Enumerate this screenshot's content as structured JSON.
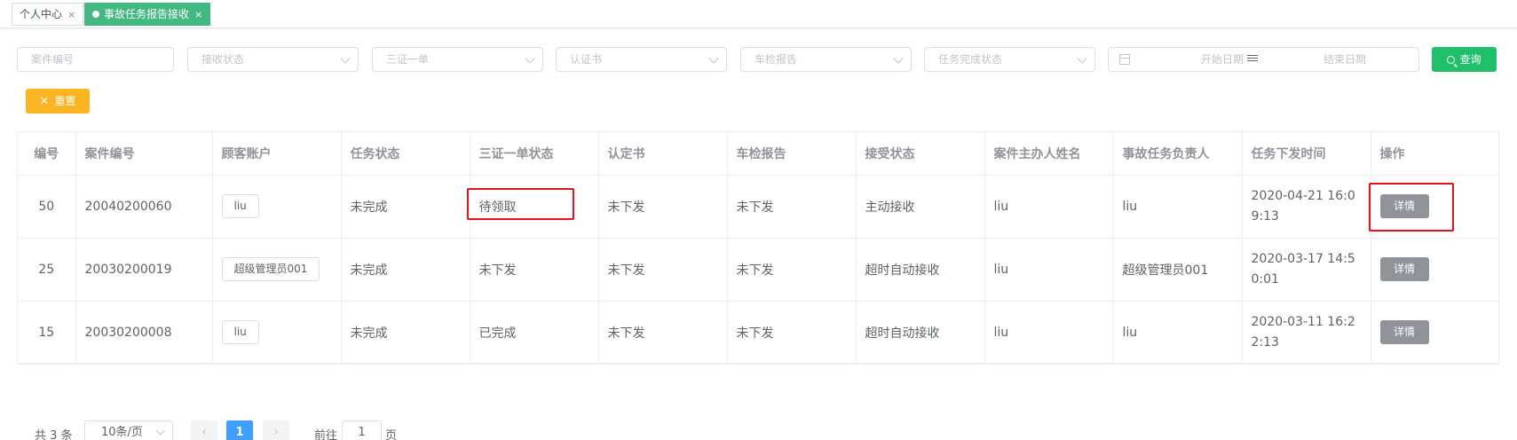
{
  "tabs": [
    {
      "label": "个人中心",
      "close": "×",
      "active": false
    },
    {
      "label": "事故任务报告接收",
      "close": "×",
      "active": true
    }
  ],
  "filters": {
    "case_no_placeholder": "案件编号",
    "receive_status_placeholder": "接收状态",
    "three_cert_placeholder": "三证一单",
    "certificate_placeholder": "认证书",
    "vehicle_report_placeholder": "车检报告",
    "task_complete_placeholder": "任务完成状态",
    "start_date_placeholder": "开始日期",
    "end_date_placeholder": "结束日期",
    "search_label": "查询",
    "reset_label": "重置"
  },
  "table": {
    "headers": [
      "编号",
      "案件编号",
      "顾客账户",
      "任务状态",
      "三证一单状态",
      "认定书",
      "车检报告",
      "接受状态",
      "案件主办人姓名",
      "事故任务负责人",
      "任务下发时间",
      "操作"
    ],
    "rows": [
      {
        "id": "50",
        "case_no": "20040200060",
        "account": "liu",
        "task_status": "未完成",
        "three_cert": "待领取",
        "certificate": "未下发",
        "vehicle_report": "未下发",
        "accept_status": "主动接收",
        "organizer": "liu",
        "manager": "liu",
        "issue_time": "2020-04-21 16:09:13",
        "action": "详情"
      },
      {
        "id": "25",
        "case_no": "20030200019",
        "account": "超级管理员001",
        "task_status": "未完成",
        "three_cert": "未下发",
        "certificate": "未下发",
        "vehicle_report": "未下发",
        "accept_status": "超时自动接收",
        "organizer": "liu",
        "manager": "超级管理员001",
        "issue_time": "2020-03-17 14:50:01",
        "action": "详情"
      },
      {
        "id": "15",
        "case_no": "20030200008",
        "account": "liu",
        "task_status": "未完成",
        "three_cert": "已完成",
        "certificate": "未下发",
        "vehicle_report": "未下发",
        "accept_status": "超时自动接收",
        "organizer": "liu",
        "manager": "liu",
        "issue_time": "2020-03-11 16:22:13",
        "action": "详情"
      }
    ]
  },
  "pagination": {
    "total": "共 3 条",
    "page_size": "10条/页",
    "current_page": "1",
    "goto_label": "前往",
    "goto_value": "1",
    "page_suffix": "页"
  },
  "colors": {
    "tab_active": "#42b983",
    "search_button": "#20c06b",
    "reset_button": "#fbb422",
    "detail_button": "#909399",
    "current_page": "#409eff",
    "highlight_box": "#e8131a"
  }
}
